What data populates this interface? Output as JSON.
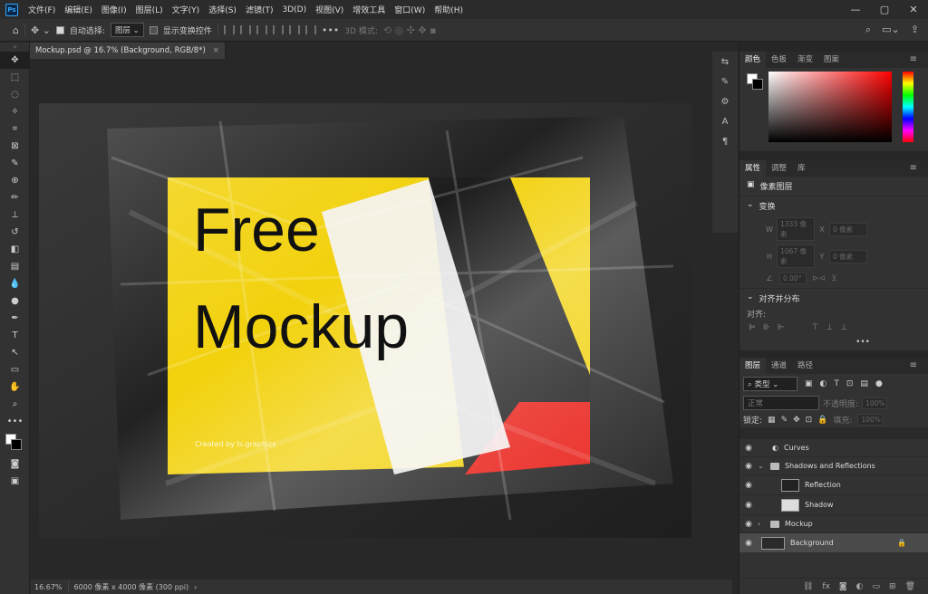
{
  "app": {
    "logo": "Ps"
  },
  "menu": [
    "文件(F)",
    "编辑(E)",
    "图像(I)",
    "图层(L)",
    "文字(Y)",
    "选择(S)",
    "滤镜(T)",
    "3D(D)",
    "视图(V)",
    "增效工具",
    "窗口(W)",
    "帮助(H)"
  ],
  "window_controls": [
    "—",
    "▢",
    "✕"
  ],
  "options": {
    "auto_select_label": "自动选择:",
    "layer_dropdown": "图层",
    "show_transform": "显示变换控件",
    "mode3d": "3D 模式:"
  },
  "document_tab": {
    "title": "Mockup.psd @ 16.7% (Background, RGB/8*)",
    "close": "×"
  },
  "mockup": {
    "line1": "Free",
    "line2": "Mockup",
    "credit": "Created by ls.graphics"
  },
  "status": {
    "zoom": "16.67%",
    "info": "6000 像素 x 4000 像素 (300 ppi)"
  },
  "color_panel": {
    "tabs": [
      "颜色",
      "色板",
      "渐变",
      "图案"
    ],
    "active": 0
  },
  "props_panel": {
    "tabs": [
      "属性",
      "调整",
      "库"
    ],
    "active": 0,
    "layer_type": "像素图层",
    "transform_title": "变换",
    "w_label": "W",
    "w_val": "1333 像素",
    "x_label": "X",
    "x_val": "0 像素",
    "h_label": "H",
    "h_val": "1067 像素",
    "y_label": "Y",
    "y_val": "0 像素",
    "angle_val": "0.00°",
    "align_title": "对齐并分布",
    "align_sub": "对齐:",
    "more": "•••"
  },
  "layers_panel": {
    "tabs": [
      "图层",
      "通道",
      "路径"
    ],
    "active": 0,
    "kind_filter": "类型",
    "blend_mode": "正常",
    "opacity_label": "不透明度:",
    "opacity_val": "100%",
    "lock_label": "锁定:",
    "fill_label": "填充:",
    "fill_val": "100%",
    "layers": [
      {
        "name": "Curves",
        "type": "adjustment",
        "indent": 0
      },
      {
        "name": "Shadows and Reflections",
        "type": "group-open",
        "indent": 0
      },
      {
        "name": "Reflection",
        "type": "layer",
        "indent": 1
      },
      {
        "name": "Shadow",
        "type": "layer",
        "indent": 1
      },
      {
        "name": "Mockup",
        "type": "group",
        "indent": 0
      },
      {
        "name": "Background",
        "type": "layer",
        "indent": 0,
        "selected": true
      }
    ]
  }
}
